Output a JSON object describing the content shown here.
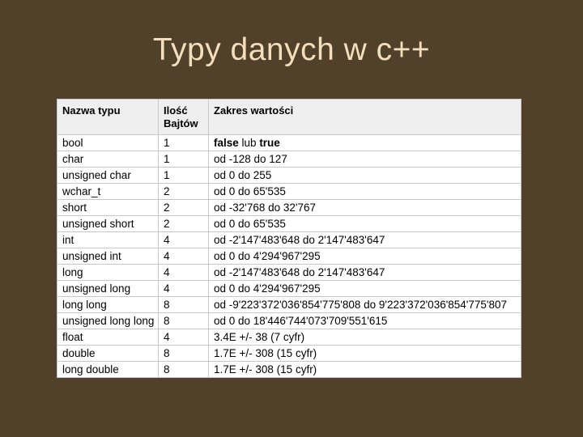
{
  "slide": {
    "title": "Typy danych w c++",
    "background_color": "#51402a",
    "title_color": "#f4debc"
  },
  "table": {
    "headers": [
      "Nazwa typu",
      "Ilość Bajtów",
      "Zakres wartości"
    ],
    "header_lines": {
      "col1": [
        "Nazwa typu"
      ],
      "col2": [
        "Ilość",
        "Bajtów"
      ],
      "col3": [
        "Zakres wartości"
      ]
    },
    "rows": [
      {
        "type": "bool",
        "bytes": "1",
        "range": "false lub true",
        "range_bold_parts": [
          "false",
          "true"
        ]
      },
      {
        "type": "char",
        "bytes": "1",
        "range": "od -128 do 127"
      },
      {
        "type": "unsigned char",
        "bytes": "1",
        "range": "od 0 do 255"
      },
      {
        "type": "wchar_t",
        "bytes": "2",
        "range": "od 0 do 65'535"
      },
      {
        "type": "short",
        "bytes": "2",
        "range": "od -32'768 do 32'767"
      },
      {
        "type": "unsigned short",
        "bytes": "2",
        "range": "od 0 do 65'535"
      },
      {
        "type": "int",
        "bytes": "4",
        "range": "od -2'147'483'648 do 2'147'483'647"
      },
      {
        "type": "unsigned int",
        "bytes": "4",
        "range": "od 0 do 4'294'967'295"
      },
      {
        "type": "long",
        "bytes": "4",
        "range": "od -2'147'483'648 do 2'147'483'647"
      },
      {
        "type": "unsigned long",
        "bytes": "4",
        "range": "od 0 do 4'294'967'295"
      },
      {
        "type": "long long",
        "bytes": "8",
        "range": "od -9'223'372'036'854'775'808 do 9'223'372'036'854'775'807"
      },
      {
        "type": "unsigned long long",
        "bytes": "8",
        "range": "od 0 do 18'446'744'073'709'551'615"
      },
      {
        "type": "float",
        "bytes": "4",
        "range": "3.4E +/- 38 (7 cyfr)"
      },
      {
        "type": "double",
        "bytes": "8",
        "range": "1.7E +/- 308 (15 cyfr)"
      },
      {
        "type": "long double",
        "bytes": "8",
        "range": "1.7E +/- 308 (15 cyfr)"
      }
    ]
  }
}
